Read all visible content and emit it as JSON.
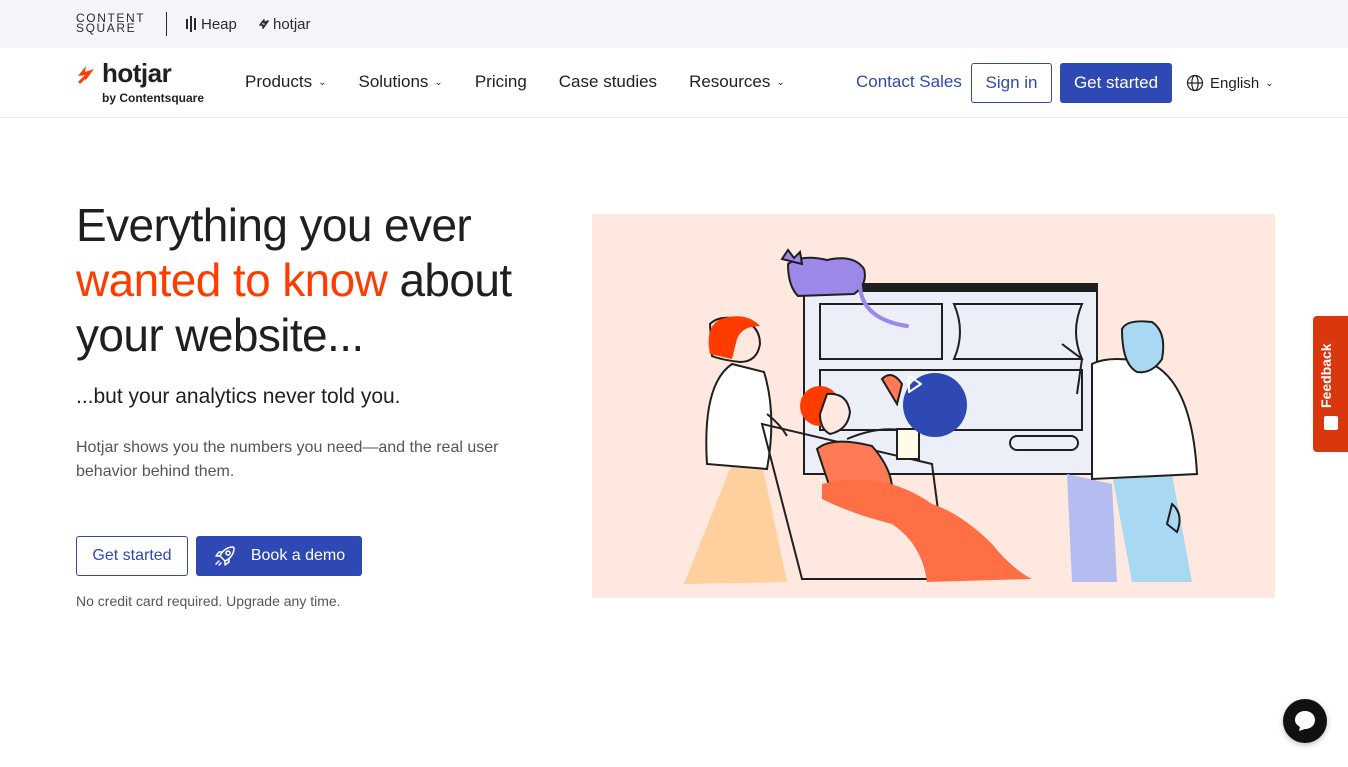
{
  "brandbar": {
    "contentsquare_line1": "CONTENT",
    "contentsquare_line2": "SQUARE",
    "heap": "Heap",
    "hotjar": "hotjar"
  },
  "nav": {
    "logo_word": "hotjar",
    "logo_by": "by Contentsquare",
    "menu": [
      {
        "label": "Products",
        "has_dropdown": true
      },
      {
        "label": "Solutions",
        "has_dropdown": true
      },
      {
        "label": "Pricing",
        "has_dropdown": false
      },
      {
        "label": "Case studies",
        "has_dropdown": false
      },
      {
        "label": "Resources",
        "has_dropdown": true
      }
    ],
    "contact_sales": "Contact Sales",
    "sign_in": "Sign in",
    "get_started": "Get started",
    "language": "English"
  },
  "hero": {
    "headline_part1": "Everything you ever",
    "headline_highlight": "wanted to know",
    "headline_part2": "about your website...",
    "subheadline": "...but your analytics never told you.",
    "description": "Hotjar shows you the numbers you need—and the real user behavior behind them.",
    "cta_primary": "Get started",
    "cta_demo": "Book a demo",
    "note": "No credit card required. Upgrade any time."
  },
  "feedback_tab": {
    "label": "Feedback"
  },
  "icons": {
    "logo": "hotjar-flame-icon",
    "globe": "globe-icon",
    "rocket": "rocket-icon",
    "play": "play-icon",
    "chat": "chat-bubble-icon",
    "feedback": "feedback-icon"
  },
  "colors": {
    "brand_blue": "#2e49b4",
    "brand_orange": "#ff3c00",
    "feedback_red": "#d9380f",
    "illustration_bg": "#fee8df",
    "brandbar_bg": "#f4f5fa"
  }
}
